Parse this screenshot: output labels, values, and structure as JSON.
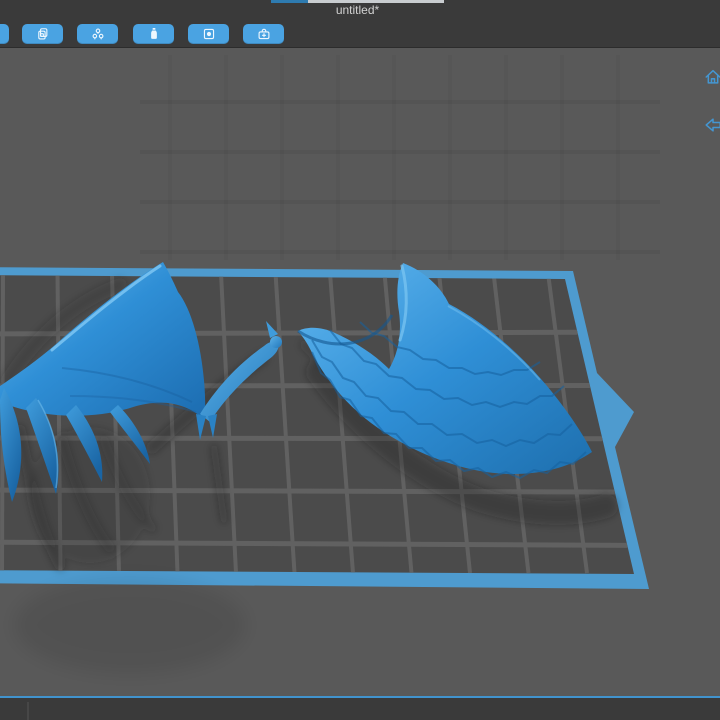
{
  "window": {
    "tab_title": "untitled*"
  },
  "toolbar": {
    "buttons": [
      {
        "name": "toolbar-button-clipped",
        "icon": "clipped-icon"
      },
      {
        "name": "toolbar-button-copy",
        "icon": "copy-icon"
      },
      {
        "name": "toolbar-button-parts",
        "icon": "triple-circle-icon"
      },
      {
        "name": "toolbar-button-resin",
        "icon": "resin-bottle-icon"
      },
      {
        "name": "toolbar-button-plate",
        "icon": "frame-dot-icon"
      },
      {
        "name": "toolbar-button-kit",
        "icon": "toolbox-icon"
      }
    ]
  },
  "viewport": {
    "view_controls": [
      {
        "name": "home-view-button",
        "icon": "home-icon"
      },
      {
        "name": "flip-view-button",
        "icon": "flip-arrow-icon"
      }
    ],
    "models": [
      {
        "name": "left-wing-model"
      },
      {
        "name": "right-wing-model"
      }
    ],
    "grid": {
      "columns": 13,
      "rows": 5
    }
  },
  "colors": {
    "accent_blue": "#4aa3e2",
    "bar_bg": "#3a3a3a",
    "tab_text": "#d2d2d2",
    "progress_blue": "#2e7bb0",
    "progress_light": "#c9cdd0",
    "viewport_bg": "#595959",
    "plate_frame": "#4e9bcf",
    "plate_surface": "#4b4b4b",
    "grid_line": "#616161",
    "model_blue": "#2e8fd8",
    "model_highlight": "#7cc6f2",
    "model_shadow_blue": "#1b66a6",
    "view_icon_blue": "#4496d1",
    "bottom_border": "#4193cd"
  }
}
